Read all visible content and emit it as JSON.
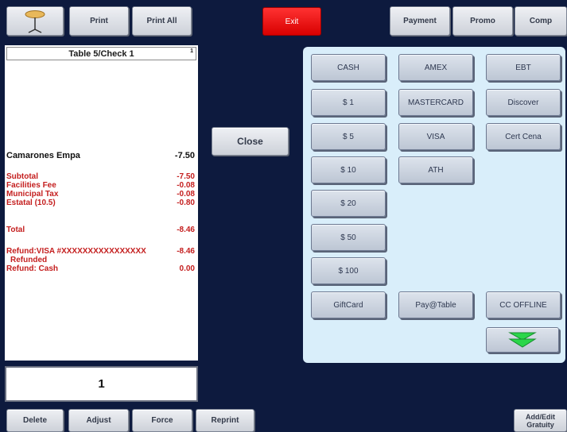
{
  "toolbar": {
    "print": "Print",
    "print_all": "Print All",
    "exit": "Exit",
    "payment": "Payment",
    "promo": "Promo",
    "comp": "Comp"
  },
  "check": {
    "title": "Table 5/Check 1",
    "seat": "1",
    "item_name": "Camarones Empa",
    "item_price": "-7.50",
    "subtotal_label": "Subtotal",
    "subtotal": "-7.50",
    "facilities_label": "Facilities Fee",
    "facilities": "-0.08",
    "municipal_label": "Municipal Tax",
    "municipal": "-0.08",
    "estatal_label": "Estatal (10.5)",
    "estatal": "-0.80",
    "total_label": "Total",
    "total": "-8.46",
    "refund_visa_label": "Refund:VISA #XXXXXXXXXXXXXXXX",
    "refund_visa": "-8.46",
    "refunded_label": "Refunded",
    "refund_cash_label": "Refund: Cash",
    "refund_cash": "0.00"
  },
  "count": "1",
  "close_label": "Close",
  "payments": {
    "cash": "CASH",
    "d1": "$ 1",
    "d5": "$ 5",
    "d10": "$ 10",
    "d20": "$ 20",
    "d50": "$ 50",
    "d100": "$ 100",
    "giftcard": "GiftCard",
    "amex": "AMEX",
    "mastercard": "MASTERCARD",
    "visa": "VISA",
    "ath": "ATH",
    "paytable": "Pay@Table",
    "ebt": "EBT",
    "discover": "Discover",
    "certcena": "Cert Cena",
    "ccoffline": "CC OFFLINE"
  },
  "bottom": {
    "delete": "Delete",
    "adjust": "Adjust",
    "force": "Force",
    "reprint": "Reprint",
    "gratuity_line1": "Add/Edit",
    "gratuity_line2": "Gratuity"
  },
  "colors": {
    "background": "#0d1a3e",
    "check_text": "#c41e1e",
    "exit": "#e80000",
    "payment_panel": "#d9eefa",
    "arrow": "#2bd64a"
  },
  "icons": {
    "table": "table-icon",
    "scroll_down": "double-chevron-down-icon"
  }
}
